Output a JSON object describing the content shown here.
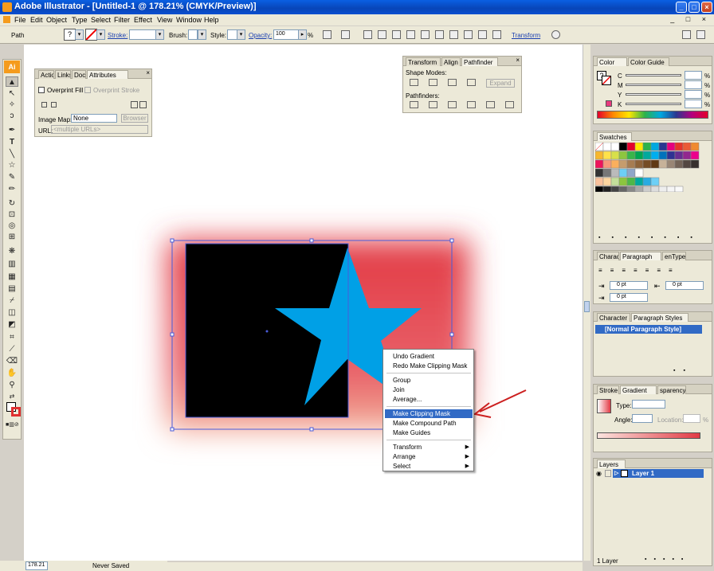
{
  "window": {
    "title": "Adobe Illustrator - [Untitled-1 @ 178.21% (CMYK/Preview)]"
  },
  "menu": [
    "File",
    "Edit",
    "Object",
    "Type",
    "Select",
    "Filter",
    "Effect",
    "View",
    "Window",
    "Help"
  ],
  "control_bar": {
    "selection": "Path",
    "stroke_label": "Stroke:",
    "brush_label": "Brush:",
    "style_label": "Style:",
    "opacity_label": "Opacity:",
    "opacity_value": "100",
    "percent": "%",
    "transform_label": "Transform"
  },
  "attributes_panel": {
    "tabs": [
      "Actio",
      "Links",
      "Docu",
      "Attributes"
    ],
    "overprint_fill": "Overprint Fill",
    "overprint_stroke": "Overprint Stroke",
    "image_map_label": "Image Map:",
    "image_map_value": "None",
    "browser_button": "Browser",
    "url_label": "URL:",
    "url_value": "<multiple URLs>"
  },
  "pathfinder_panel": {
    "tabs": [
      "Transform",
      "Align",
      "Pathfinder"
    ],
    "shape_modes": "Shape Modes:",
    "expand_button": "Expand",
    "pathfinders": "Pathfinders:"
  },
  "color_panel": {
    "tabs": [
      "Color",
      "Color Guide"
    ],
    "channels": [
      "C",
      "M",
      "Y",
      "K"
    ],
    "percent": "%"
  },
  "swatches_panel": {
    "tab": "Swatches"
  },
  "paragraph_panel": {
    "tabs": [
      "Charac",
      "Paragraph",
      "enType"
    ],
    "indent_left": "0 pt",
    "indent_right": "0 pt",
    "first_line": "0 pt"
  },
  "paragraph_styles_panel": {
    "tabs": [
      "Character S",
      "Paragraph Styles"
    ],
    "item": "[Normal Paragraph Style]"
  },
  "gradient_panel": {
    "tabs": [
      "Stroke",
      "Gradient",
      "sparency"
    ],
    "type_label": "Type:",
    "angle_label": "Angle:",
    "location_label": "Location:",
    "percent": "%"
  },
  "layers_panel": {
    "tab": "Layers",
    "layer_name": "Layer 1",
    "footer": "1 Layer"
  },
  "context_menu": {
    "items": [
      "Undo Gradient",
      "Redo Make Clipping Mask",
      "Group",
      "Join",
      "Average...",
      "Make Clipping Mask",
      "Make Compound Path",
      "Make Guides",
      "Transform",
      "Arrange",
      "Select"
    ]
  },
  "status": {
    "zoom": "178.21",
    "save_state": "Never Saved"
  },
  "colors": {
    "accent": "#316ac5",
    "star": "#00a0e6",
    "arrow": "#cc1f1f",
    "glow": "#e23a44"
  }
}
